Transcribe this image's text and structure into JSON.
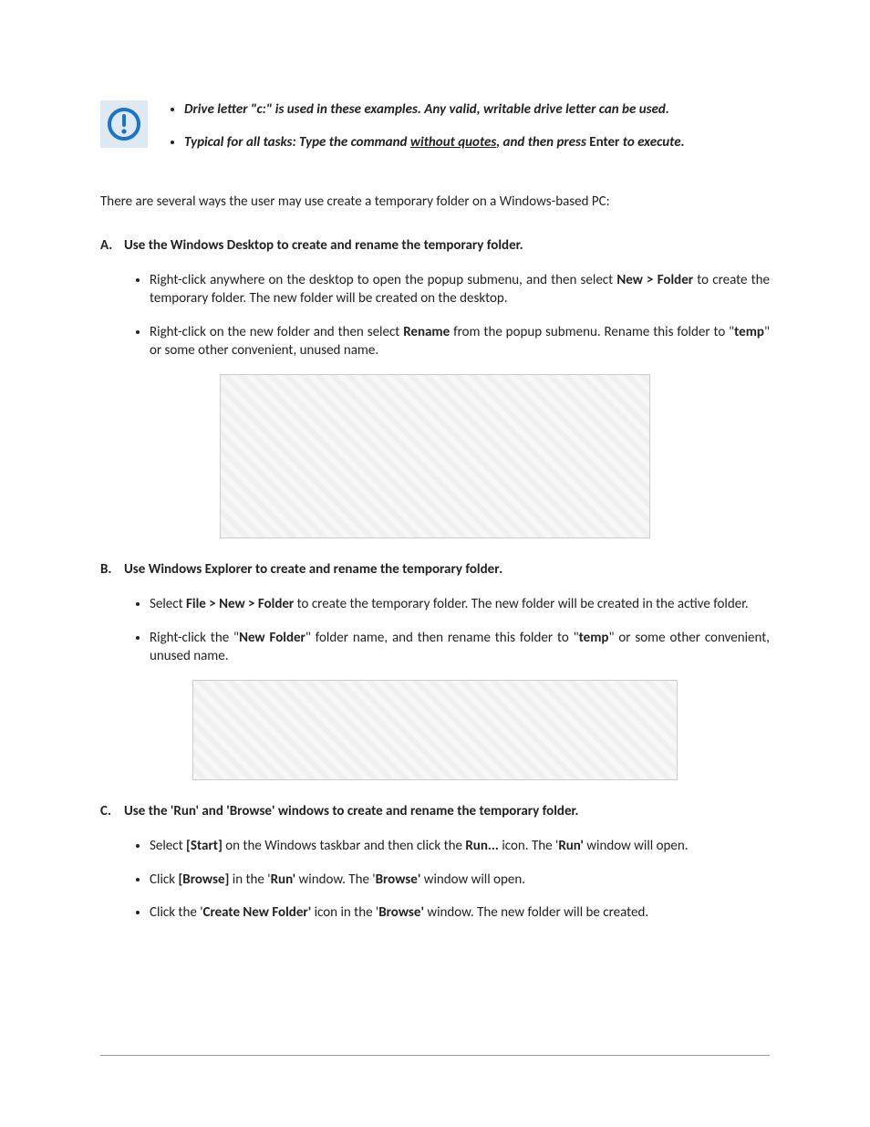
{
  "bullets_top": {
    "b1_a": "Drive letter \"c:\" is used in these examples. Any valid, writable drive letter can be used.",
    "b2_a": "Typical for all tasks: Type the command ",
    "b2_u": "without quotes",
    "b2_b": ", and then press ",
    "b2_enter": "Enter",
    "b2_c": " to execute."
  },
  "intro": "There are several ways the user may use create a temporary folder on a Windows-based PC:",
  "sections": {
    "A": {
      "label": "A.",
      "title": "Use the Windows Desktop to create and rename the temporary folder.",
      "items": {
        "i1_a": "Right-click anywhere on the desktop to open the popup submenu, and then select ",
        "i1_b": "New > Folder",
        "i1_c": " to create the temporary folder. The new folder will be created on the desktop.",
        "i2_a": "Right-click on the new folder and then select ",
        "i2_b": "Rename",
        "i2_c": " from the popup submenu. Rename this folder to \"",
        "i2_d": "temp",
        "i2_e": "\" or some other convenient, unused name."
      }
    },
    "B": {
      "label": "B.",
      "title_a": "Use Windows Explorer to create and rename the temporary folder",
      "title_b": ".",
      "items": {
        "i1_a": "Select ",
        "i1_b": "File > New > Folder",
        "i1_c": " to create the temporary folder. The new folder will be created in the active folder.",
        "i2_a": "Right-click the \"",
        "i2_b": "New Folder",
        "i2_c": "\" folder name, and then rename this folder to \"",
        "i2_d": "temp",
        "i2_e": "\" or some other convenient, unused name."
      }
    },
    "C": {
      "label": "C.",
      "title": "Use the 'Run' and 'Browse' windows to create and rename the temporary folder.",
      "items": {
        "i1_a": "Select ",
        "i1_b": "[Start]",
        "i1_c": " on the Windows taskbar and then click the ",
        "i1_d": "Run...",
        "i1_e": " icon. The '",
        "i1_f": "Run'",
        "i1_g": " window will open.",
        "i2_a": "Click ",
        "i2_b": "[Browse]",
        "i2_c": " in the '",
        "i2_d": "Run'",
        "i2_e": " window. The '",
        "i2_f": "Browse'",
        "i2_g": " window will open.",
        "i3_a": "Click the '",
        "i3_b": "Create New Folder'",
        "i3_c": " icon in the '",
        "i3_d": "Browse'",
        "i3_e": " window. The new folder will be created."
      }
    }
  }
}
